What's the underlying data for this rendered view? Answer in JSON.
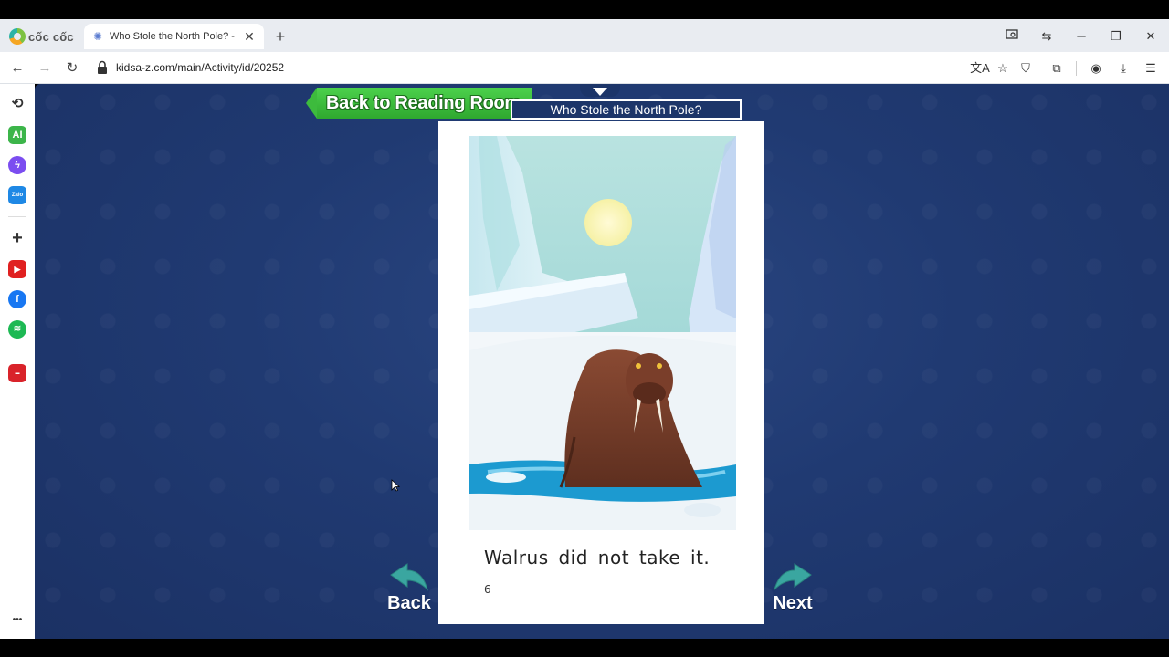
{
  "browser": {
    "logo_text": "cốc cốc",
    "tab": {
      "title": "Who Stole the North Pole? - Ki",
      "favicon": "kidsa-z-icon"
    },
    "url": "kidsa-z.com/main/Activity/id/20252",
    "toolbar_icons": [
      "translate-icon",
      "star-icon",
      "shield-icon",
      "extensions-icon",
      "profile-icon",
      "download-icon",
      "menu-icon"
    ],
    "window_controls": [
      "screen-search-icon",
      "back-forward-icon",
      "minimize-icon",
      "restore-icon",
      "close-icon"
    ]
  },
  "sidebar": {
    "items": [
      {
        "name": "history-icon",
        "label": ""
      },
      {
        "name": "ai-icon",
        "label": "AI",
        "color": "#3cb54a"
      },
      {
        "name": "messenger-icon",
        "label": "",
        "color": "#7b4df0"
      },
      {
        "name": "zalo-icon",
        "label": "Zalo",
        "color": "#1e88e5"
      },
      {
        "name": "add-icon",
        "label": ""
      },
      {
        "name": "youtube-icon",
        "label": "",
        "color": "#e02020"
      },
      {
        "name": "facebook-icon",
        "label": "",
        "color": "#1877f2"
      },
      {
        "name": "spotify-icon",
        "label": "",
        "color": "#1db954"
      },
      {
        "name": "app-icon",
        "label": "",
        "color": "#d9232a"
      },
      {
        "name": "more-icon",
        "label": "•••"
      }
    ]
  },
  "reader": {
    "back_to_room": "Back to Reading Room",
    "book_title": "Who Stole the North Pole?",
    "page_text": "Walrus did not take it.",
    "page_number": "6",
    "back_label": "Back",
    "next_label": "Next",
    "accent_green": "#3dbb3d",
    "arrow_teal": "#3aa6a0"
  }
}
